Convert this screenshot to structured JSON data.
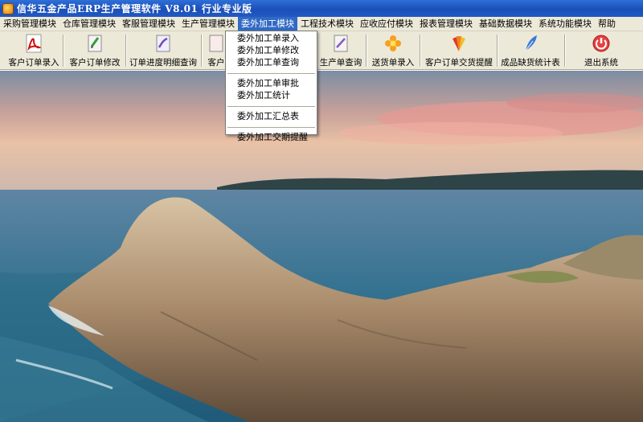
{
  "window": {
    "title": "信华五金产品ERP生产管理软件   V8.01 行业专业版"
  },
  "menubar": {
    "items": [
      {
        "label": "采购管理模块"
      },
      {
        "label": "仓库管理模块"
      },
      {
        "label": "客服管理模块"
      },
      {
        "label": "生产管理模块"
      },
      {
        "label": "委外加工模块"
      },
      {
        "label": "工程技术模块"
      },
      {
        "label": "应收应付模块"
      },
      {
        "label": "报表管理模块"
      },
      {
        "label": "基础数据模块"
      },
      {
        "label": "系统功能模块"
      },
      {
        "label": "帮助"
      }
    ],
    "active_index": 4
  },
  "toolbar": {
    "items": [
      {
        "label": "客户订单录入",
        "icon": "pdf-icon"
      },
      {
        "label": "客户订单修改",
        "icon": "edit-document-icon"
      },
      {
        "label": "订单进度明细查询",
        "icon": "progress-document-icon"
      },
      {
        "label": "客户",
        "icon": "document-icon"
      },
      {
        "label": "生产单查询",
        "icon": "search-document-icon"
      },
      {
        "label": "送货单录入",
        "icon": "flower-icon"
      },
      {
        "label": "客户订单交货提醒",
        "icon": "fan-icon"
      },
      {
        "label": "成品缺货统计表",
        "icon": "feather-icon"
      },
      {
        "label": "退出系统",
        "icon": "power-icon"
      }
    ]
  },
  "dropdown": {
    "groups": [
      [
        "委外加工单录入",
        "委外加工单修改",
        "委外加工单查询"
      ],
      [
        "委外加工单审批",
        "委外加工统计"
      ],
      [
        "委外加工汇总表"
      ],
      [
        "委外加工交期提醒"
      ]
    ]
  },
  "colors": {
    "titlebar": "#1a4fb7",
    "menu_highlight": "#316ac5",
    "chrome": "#ece9d8"
  }
}
